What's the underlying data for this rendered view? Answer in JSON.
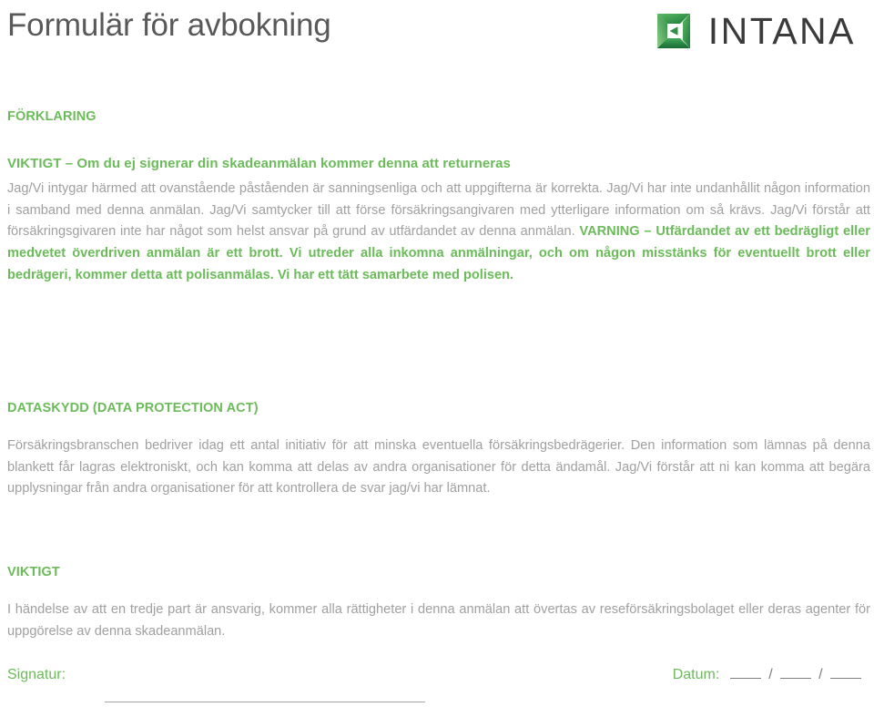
{
  "header": {
    "title": "Formulär för avbokning",
    "logo": {
      "mark_name": "intana-logo-mark",
      "wordmark": "INTANA"
    }
  },
  "colors": {
    "green": "#6cbb5a",
    "title_gray": "#595959",
    "body_gray": "#a0a0a0",
    "rule_gray": "#a6a6a6"
  },
  "sections": {
    "forklaring": {
      "heading": "FÖRKLARING",
      "lead": "VIKTIGT – Om du ej signerar din skadeanmälan kommer denna att returneras",
      "body_plain": "Jag/Vi intygar härmed att ovanstående påståenden är sanningsenliga och att uppgifterna är korrekta. Jag/Vi har inte undanhållit någon information i samband med denna anmälan. Jag/Vi samtycker till att förse försäkringsangivaren med ytterligare information om så krävs. Jag/Vi förstår att försäkringsgivaren inte har något som helst ansvar på grund av utfärdandet av denna anmälan. ",
      "body_emphasis": "VARNING – Utfärdandet av ett bedrägligt eller medvetet överdriven anmälan är ett brott. Vi utreder alla inkomna anmälningar, och om någon misstänks för eventuellt brott eller bedrägeri, kommer detta att polisanmälas. Vi har ett tätt samarbete med polisen."
    },
    "dataskydd": {
      "heading": "DATASKYDD (DATA PROTECTION ACT)",
      "body": "Försäkringsbranschen bedriver idag ett antal initiativ för att minska eventuella försäkringsbedrägerier. Den information som lämnas på denna blankett får lagras elektroniskt, och kan komma att delas av andra organisationer för detta ändamål. Jag/Vi förstår att ni kan komma att begära upplysningar från andra organisationer för att kontrollera de svar jag/vi har lämnat."
    },
    "viktigt": {
      "heading": "VIKTIGT",
      "body": "I händelse av att en tredje part är ansvarig, kommer alla rättigheter i denna anmälan att övertas av reseförsäkringsbolaget eller deras agenter för uppgörelse av denna skadeanmälan."
    }
  },
  "footer": {
    "signature_label": "Signatur:",
    "date_label": "Datum:",
    "date_separator": "/"
  }
}
